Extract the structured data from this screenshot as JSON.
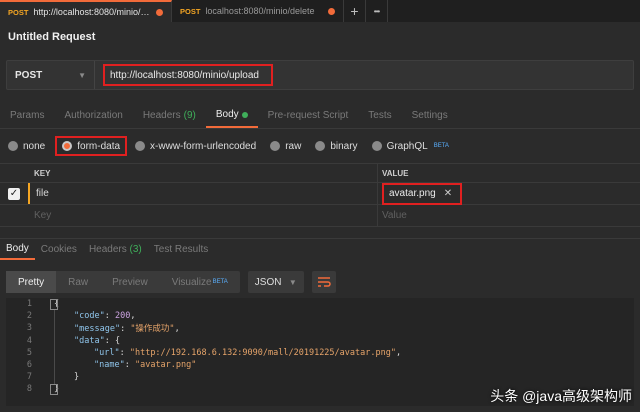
{
  "tabs": [
    {
      "method": "POST",
      "url": "http://localhost:8080/minio/u...",
      "active": true
    },
    {
      "method": "POST",
      "url": "localhost:8080/minio/delete",
      "active": false
    }
  ],
  "tab_actions": {
    "new_tab": "+",
    "more": "•••"
  },
  "request": {
    "title": "Untitled Request",
    "method": "POST",
    "url": "http://localhost:8080/minio/upload"
  },
  "request_tabs": {
    "params": "Params",
    "authorization": "Authorization",
    "headers": "Headers",
    "headers_count": "(9)",
    "body": "Body",
    "prerequest": "Pre-request Script",
    "tests": "Tests",
    "settings": "Settings"
  },
  "body_types": {
    "none": "none",
    "form_data": "form-data",
    "urlencoded": "x-www-form-urlencoded",
    "raw": "raw",
    "binary": "binary",
    "graphql": "GraphQL",
    "graphql_badge": "BETA"
  },
  "form_table": {
    "key_header": "KEY",
    "value_header": "VALUE",
    "row_key": "file",
    "row_value": "avatar.png",
    "key_placeholder": "Key",
    "value_placeholder": "Value"
  },
  "response_tabs": {
    "body": "Body",
    "cookies": "Cookies",
    "headers": "Headers",
    "headers_count": "(3)",
    "test_results": "Test Results"
  },
  "view_modes": {
    "pretty": "Pretty",
    "raw": "Raw",
    "preview": "Preview",
    "visualize": "Visualize",
    "visualize_badge": "BETA",
    "format": "JSON"
  },
  "code_lines": {
    "n1": "1",
    "n2": "2",
    "n3": "3",
    "n4": "4",
    "n5": "5",
    "n6": "6",
    "n7": "7",
    "n8": "8",
    "l1": "{",
    "l2_key": "\"code\"",
    "l2_val": "200",
    "l3_key": "\"message\"",
    "l3_val": "\"操作成功\"",
    "l4_key": "\"data\"",
    "l4_rest": ": {",
    "l5_key": "\"url\"",
    "l5_val": "\"http://192.168.6.132:9090/mall/20191225/avatar.png\"",
    "l6_key": "\"name\"",
    "l6_val": "\"avatar.png\"",
    "l7": "}",
    "l8": "}"
  },
  "watermark": "头条 @java高级架构师",
  "colors": {
    "accent": "#f26b3a",
    "highlight_box": "#e02020",
    "ok": "#3fae5a"
  }
}
